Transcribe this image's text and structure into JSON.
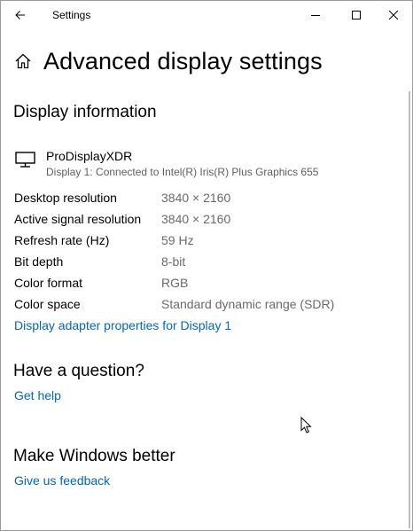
{
  "window": {
    "title": "Settings",
    "back_icon": "arrow-left-icon",
    "minimize_icon": "minimize-icon",
    "maximize_icon": "maximize-icon",
    "close_icon": "close-icon"
  },
  "header": {
    "home_icon": "home-icon",
    "title": "Advanced display settings"
  },
  "display_info": {
    "heading": "Display information",
    "monitor_icon": "monitor-icon",
    "monitor_name": "ProDisplayXDR",
    "monitor_description": "Display 1: Connected to Intel(R) Iris(R) Plus Graphics 655",
    "rows": [
      {
        "label": "Desktop resolution",
        "value": "3840 × 2160"
      },
      {
        "label": "Active signal resolution",
        "value": "3840 × 2160"
      },
      {
        "label": "Refresh rate (Hz)",
        "value": "59 Hz"
      },
      {
        "label": "Bit depth",
        "value": "8-bit"
      },
      {
        "label": "Color format",
        "value": "RGB"
      },
      {
        "label": "Color space",
        "value": "Standard dynamic range (SDR)"
      }
    ],
    "adapter_link": "Display adapter properties for Display 1"
  },
  "question": {
    "heading": "Have a question?",
    "help_link": "Get help"
  },
  "feedback": {
    "heading": "Make Windows better",
    "feedback_link": "Give us feedback"
  },
  "colors": {
    "link": "#0067c0",
    "secondary_text": "#6a6a6a"
  }
}
